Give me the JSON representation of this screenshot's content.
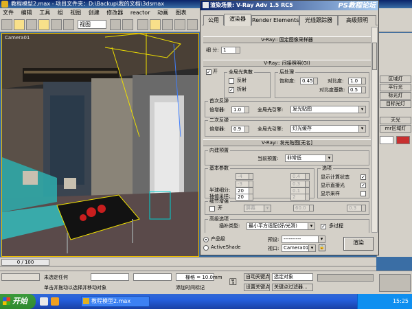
{
  "max": {
    "title": "教程模型2.max - 项目文件夹：D:\\Backup\\我的文档\\3dsmax",
    "menu": [
      "文件",
      "编辑",
      "工具",
      "组",
      "视图",
      "创建",
      "修改器",
      "reactor",
      "动画",
      "图表"
    ],
    "view_select": "视图",
    "viewport_label": "Camera01",
    "command_panel": [
      "区域灯",
      "平行光",
      "标光灯",
      "目标光灯",
      "天光",
      "mr区域灯"
    ],
    "frame_counter": "0 / 100",
    "status": {
      "selection": "未选定任何",
      "prompt": "单击并拖动以选择并移动对象",
      "add_time_tag": "添加时间标记",
      "grid": "栅格 = 10.0mm",
      "auto_key": "自动关键点",
      "set_key": "设置关键点",
      "selected_object": "选定对象",
      "key_filters": "关键点过滤器..."
    },
    "taskbar": {
      "start": "开始",
      "task": "教程模型2.max",
      "clock": "15:25"
    }
  },
  "dialog": {
    "title": "渲染场景: V-Ray Adv 1.5 RC5",
    "watermark": "PS教程论坛",
    "tabs": [
      "公用",
      "渲染器",
      "Render Elements",
      "光线跟踪器",
      "高级照明"
    ],
    "rollout_fixed": "V-Ray:: 固定图像采样器",
    "subdivs_label": "细 分:",
    "subdivs_value": "1",
    "rollout_gi": "V-Ray:: 间接照明(GI)",
    "gi_on_label": "开",
    "gi_caustics": {
      "label": "全局光焦散",
      "reflective": "反射",
      "refractive": "折射"
    },
    "post_processing": {
      "label": "后处理",
      "saturation_label": "饱和度:",
      "saturation_value": "0.45",
      "contrast_label": "对比度:",
      "contrast_value": "1.0",
      "contrast_base_label": "对比度基数:",
      "contrast_base_value": "0.5"
    },
    "primary_bounces": {
      "label": "首次反弹",
      "multiplier_label": "倍增器:",
      "multiplier_value": "1.0",
      "engine_label": "全局光引擎:",
      "engine_value": "发光贴图"
    },
    "secondary_bounces": {
      "label": "二次反弹",
      "multiplier_label": "倍增器:",
      "multiplier_value": "0.9",
      "engine_label": "全局光引擎:",
      "engine_value": "灯光缓存"
    },
    "rollout_irradiance": "V-Ray:: 发光贴图[无名]",
    "preset_group": {
      "label": "内建预置",
      "current_preset_label": "当前预置:",
      "current_preset_value": "非常低"
    },
    "basic_params": {
      "label": "基本参数",
      "min_rate_value": "-4",
      "max_rate_value": "-3",
      "hsph_label": "半球细分:",
      "hsph_value": "20",
      "interp_label": "插值采样:",
      "interp_value": "20",
      "clr_thresh_value": "0.4",
      "nrm_thresh_value": "0.3",
      "dist_thresh_value": "0.1",
      "interp_frames_value": "2"
    },
    "options": {
      "label": "选项",
      "show_calc": "显示计算状态",
      "show_direct": "显示直接光",
      "show_samples": "显示采样"
    },
    "detail": {
      "label": "细节增强",
      "on_label": "开",
      "scale_value": "屏幕",
      "radius_value": "60.0",
      "subdivs_mult_value": "0.3"
    },
    "advanced": {
      "label": "高级选项",
      "interp_type_label": "插补类型:",
      "interp_type_value": "最小平方适配(好/光滑)",
      "multipass_label": "多过程"
    },
    "bottom": {
      "production": "产品级",
      "activeshade": "ActiveShade",
      "preset_label": "预设:",
      "preset_value": "----------",
      "viewport_label": "视口:",
      "viewport_value": "Camera01",
      "render_button": "渲染"
    }
  },
  "colors": {
    "titlebar": "#0a246a",
    "panel": "#d4d0c8",
    "taskbar": "#245edb",
    "start": "#3c9a3c",
    "viewport_bg": "#2b2b2b",
    "selection_wire": "#f0e000"
  }
}
